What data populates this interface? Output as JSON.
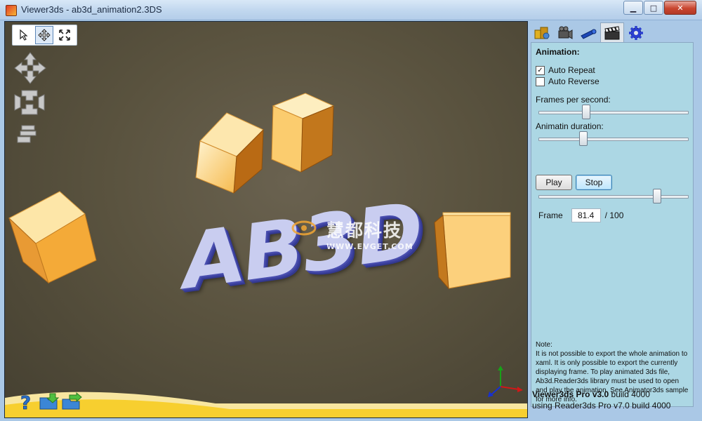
{
  "window": {
    "title": "Viewer3ds - ab3d_animation2.3DS",
    "minimize_glyph": "▁",
    "maximize_glyph": "□",
    "close_glyph": "✕"
  },
  "viewport": {
    "logo_text": "AB3D",
    "watermark_chinese": "慧都科技",
    "watermark_url": "WWW.EVGET.COM",
    "tools": [
      "select-arrow-icon",
      "move-icon",
      "zoom-extents-icon"
    ],
    "active_tool": "move-icon"
  },
  "panel": {
    "tabs": [
      "scene-objects-icon",
      "camera-icon",
      "light-icon",
      "animation-clapper-icon",
      "settings-gear-icon"
    ],
    "active_tab": "animation-clapper-icon",
    "heading": "Animation:",
    "auto_repeat_label": "Auto Repeat",
    "auto_repeat_checked": true,
    "auto_reverse_label": "Auto Reverse",
    "auto_reverse_checked": false,
    "fps_label": "Frames per second:",
    "fps_slider_fraction": 0.31,
    "duration_label": "Animatin duration:",
    "duration_slider_fraction": 0.29,
    "play_label": "Play",
    "stop_label": "Stop",
    "position_slider_fraction": 0.815,
    "frame_label": "Frame",
    "frame_value": "81.4",
    "frame_total": "/ 100",
    "note_title": "Note:",
    "note_text": "It is not possible to export the whole animation to xaml. It is only possible to export the currently displaying frame. To play animated 3ds file, Ab3d.Reader3ds library must be used to open and play the animation. See Animator3ds sample for more info.",
    "status_product": "Viewer3ds Pro v3.0",
    "status_build": " build 4000",
    "status_line2": "using Reader3ds Pro v7.0 build 4000"
  },
  "colors": {
    "accent": "#3c7fb1",
    "panel_bg": "#acd7e4",
    "viewport_bg": "#5a533f",
    "cube": "#f2a634",
    "logo": "#c9cdf0"
  }
}
